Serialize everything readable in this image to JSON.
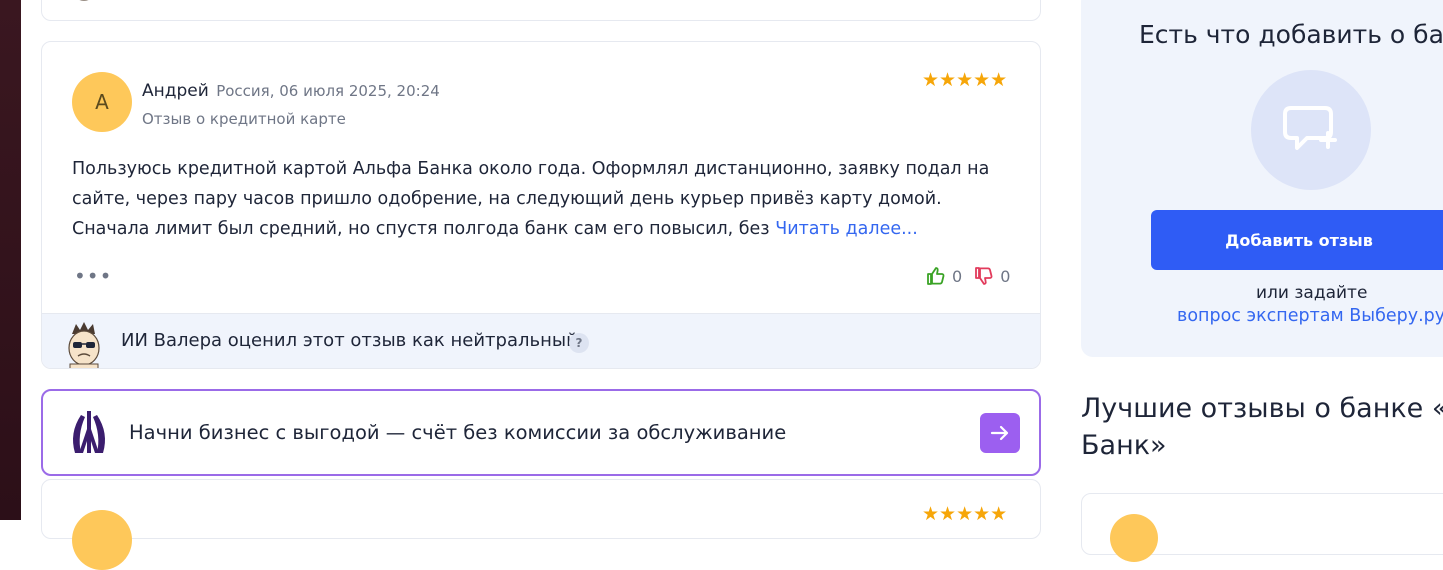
{
  "review": {
    "avatar_letter": "А",
    "author": "Андрей",
    "meta": "Россия, 06 июля 2025, 20:24",
    "subtitle": "Отзыв о кредитной карте",
    "stars": "★★★★★",
    "text": "Пользуюсь кредитной картой Альфа Банка около года. Оформлял дистанционно, заявку подал на сайте, через пару часов пришло одобрение, на следующий день курьер привёз карту домой. Сначала лимит был средний, но спустя полгода банк сам его повысил, без",
    "read_more": "Читать далее...",
    "more": "•••",
    "likes": "0",
    "dislikes": "0",
    "ai_verdict": "ИИ Валера оценил этот отзыв как нейтральный",
    "help": "?"
  },
  "promo": {
    "text": "Начни бизнес с выгодой — счёт без комиссии за обслуживание"
  },
  "next_review": {
    "stars": "★★★★★"
  },
  "sidebar": {
    "title": "Есть что добавить о бан",
    "button": "Добавить отзыв",
    "or_text": "или задайте",
    "link": "вопрос экспертам Выберу.ру"
  },
  "best_reviews": {
    "title": "Лучшие отзывы о банке «А Банк»"
  },
  "colors": {
    "accent_blue": "#2f5cf5",
    "promo_purple": "#9c5ff0",
    "star": "#f6a609",
    "like_green": "#3aa325",
    "dislike_red": "#e23b5c"
  }
}
